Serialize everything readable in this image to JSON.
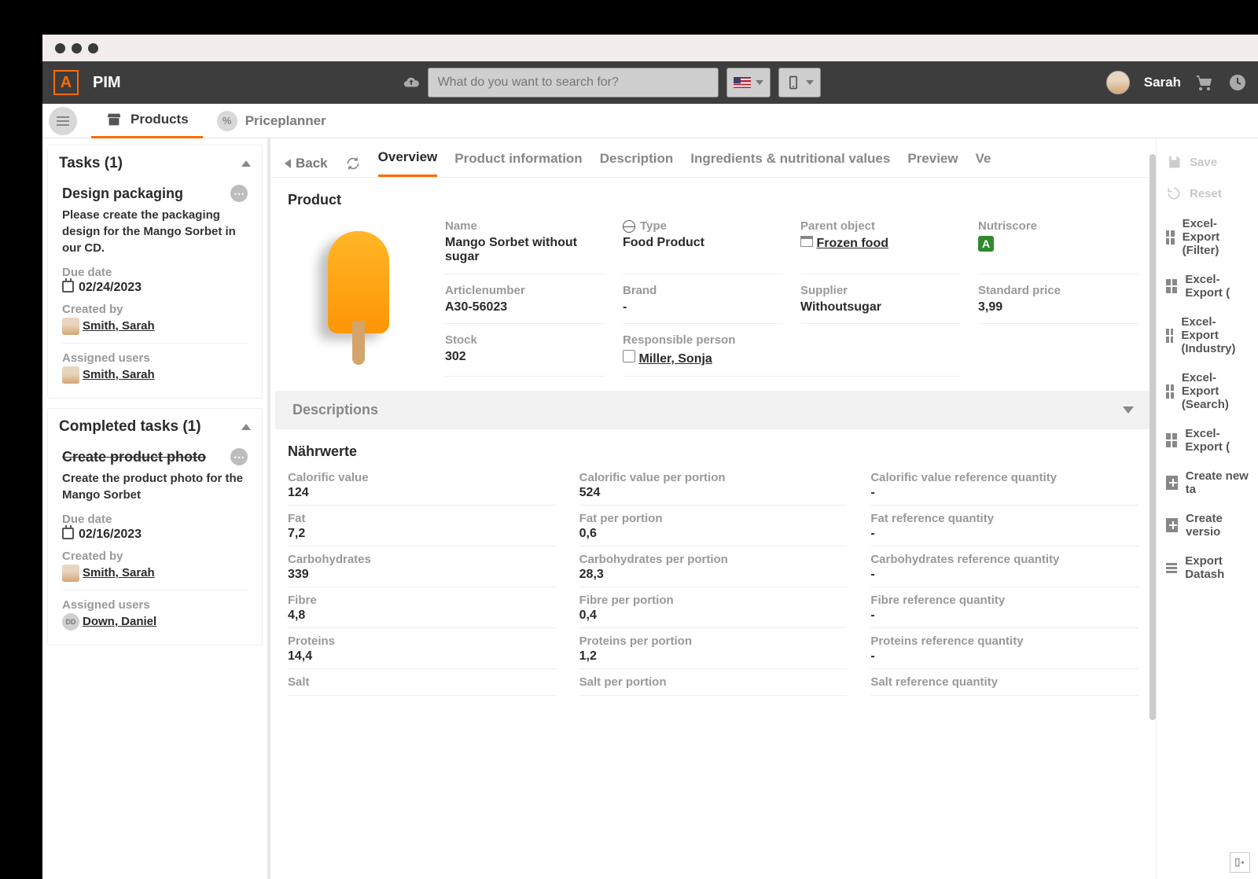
{
  "app": {
    "title": "PIM"
  },
  "search": {
    "placeholder": "What do you want to search for?"
  },
  "user": {
    "name": "Sarah"
  },
  "nav": {
    "products": "Products",
    "priceplanner": "Priceplanner"
  },
  "sidebar": {
    "tasks_header": "Tasks (1)",
    "completed_header": "Completed tasks (1)",
    "task1": {
      "title": "Design packaging",
      "desc": "Please create the packaging design for the Mango Sorbet in our CD.",
      "due_label": "Due date",
      "due": "02/24/2023",
      "created_label": "Created by",
      "created": "Smith, Sarah",
      "assigned_label": "Assigned users",
      "assigned": "Smith, Sarah"
    },
    "task2": {
      "title": "Create product photo",
      "desc": "Create the product photo for the Mango Sorbet",
      "due_label": "Due date",
      "due": "02/16/2023",
      "created_label": "Created by",
      "created": "Smith, Sarah",
      "assigned_label": "Assigned users",
      "assigned": "Down, Daniel",
      "assigned_initials": "DD"
    }
  },
  "tabs": {
    "back": "Back",
    "overview": "Overview",
    "product_info": "Product information",
    "description": "Description",
    "ingredients": "Ingredients & nutritional values",
    "preview": "Preview",
    "versions": "Ve"
  },
  "product": {
    "header": "Product",
    "name_l": "Name",
    "name": "Mango Sorbet without sugar",
    "type_l": "Type",
    "type": "Food Product",
    "parent_l": "Parent object",
    "parent": "Frozen food",
    "nutriscore_l": "Nutriscore",
    "nutriscore": "A",
    "article_l": "Articlenumber",
    "article": "A30-56023",
    "brand_l": "Brand",
    "brand": "-",
    "supplier_l": "Supplier",
    "supplier": "Withoutsugar",
    "price_l": "Standard price",
    "price": "3,99",
    "stock_l": "Stock",
    "stock": "302",
    "resp_l": "Responsible person",
    "resp": "Miller, Sonja"
  },
  "descriptions": {
    "title": "Descriptions"
  },
  "nutrition": {
    "header": "Nährwerte",
    "rows": [
      {
        "a_l": "Calorific value",
        "a": "124",
        "b_l": "Calorific value per portion",
        "b": "524",
        "c_l": "Calorific value reference quantity",
        "c": "-"
      },
      {
        "a_l": "Fat",
        "a": "7,2",
        "b_l": "Fat per portion",
        "b": "0,6",
        "c_l": "Fat reference quantity",
        "c": "-"
      },
      {
        "a_l": "Carbohydrates",
        "a": "339",
        "b_l": "Carbohydrates per portion",
        "b": "28,3",
        "c_l": "Carbohydrates reference quantity",
        "c": "-"
      },
      {
        "a_l": "Fibre",
        "a": "4,8",
        "b_l": "Fibre per portion",
        "b": "0,4",
        "c_l": "Fibre reference quantity",
        "c": "-"
      },
      {
        "a_l": "Proteins",
        "a": "14,4",
        "b_l": "Proteins per portion",
        "b": "1,2",
        "c_l": "Proteins reference quantity",
        "c": "-"
      },
      {
        "a_l": "Salt",
        "a": "",
        "b_l": "Salt per portion",
        "b": "",
        "c_l": "Salt reference quantity",
        "c": ""
      }
    ]
  },
  "actions": {
    "save": "Save",
    "reset": "Reset",
    "ex1": "Excel-Export (Filter)",
    "ex2": "Excel-Export (",
    "ex3": "Excel-Export (Industry)",
    "ex4": "Excel-Export (Search)",
    "ex5": "Excel-Export (",
    "new_task": "Create new ta",
    "new_version": "Create versio",
    "datasheet": "Export Datash"
  }
}
